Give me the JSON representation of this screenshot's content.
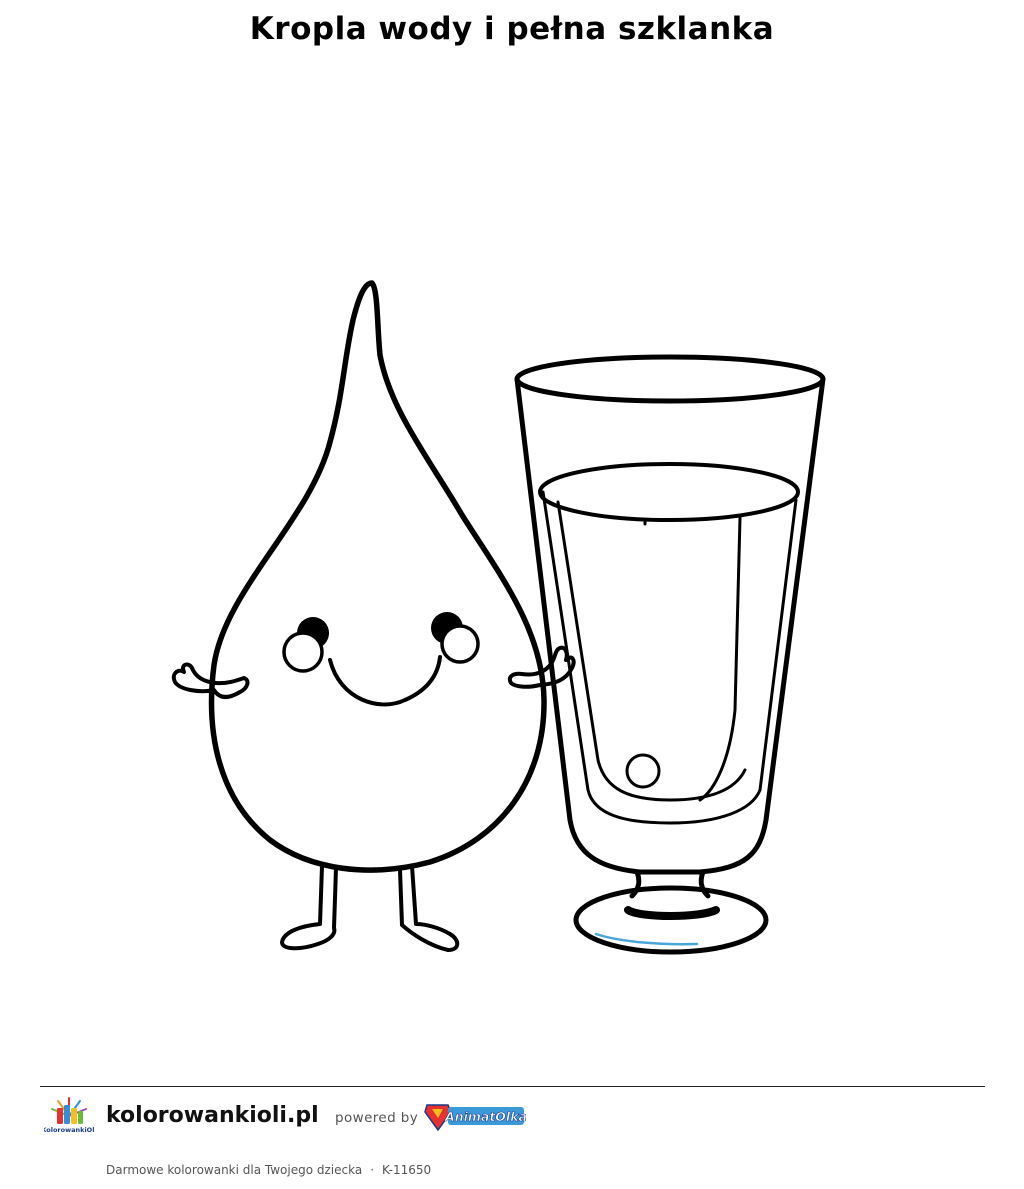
{
  "page": {
    "title": "Kropla wody i pełna szklanka"
  },
  "illustration": {
    "subjects": [
      "water-drop-character",
      "full-glass"
    ],
    "line_color": "#000000",
    "accent_color": "#4aa6d8"
  },
  "footer": {
    "site_name": "kolorowankioli.pl",
    "powered_by": "powered by",
    "partner_logo_text": "AnimatOlka",
    "logo_text": "KolorowankiOli",
    "tagline": "Darmowe kolorowanki dla Twojego dziecka",
    "separator": "·",
    "code": "K-11650"
  }
}
